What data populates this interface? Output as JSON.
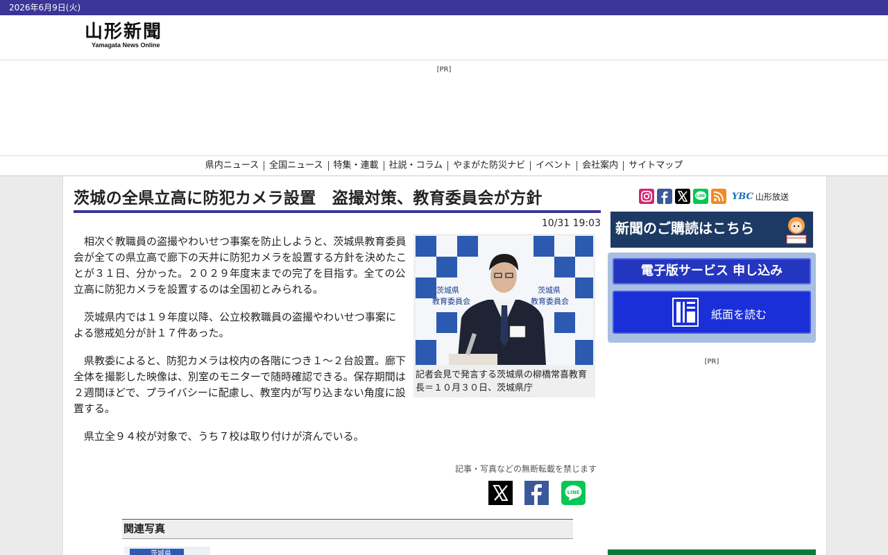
{
  "datebar": {
    "date": "2026年6月9日(火)"
  },
  "header": {
    "logo_kanji": "山形新聞",
    "logo_sub": "Yamagata News Online"
  },
  "ad": {
    "pr_label": "[PR]"
  },
  "nav": {
    "items": [
      "県内ニュース",
      "全国ニュース",
      "特集・連載",
      "社説・コラム",
      "やまがた防災ナビ",
      "イベント",
      "会社案内",
      "サイトマップ"
    ]
  },
  "article": {
    "headline": "茨城の全県立高に防犯カメラ設置　盗撮対策、教育委員会が方針",
    "timestamp": "10/31 19:03",
    "paragraphs": [
      "相次ぐ教職員の盗撮やわいせつ事案を防止しようと、茨城県教育委員会が全ての県立高で廊下の天井に防犯カメラを設置する方針を決めたことが３１日、分かった。２０２９年度末までの完了を目指す。全ての公立高に防犯カメラを設置するのは全国初とみられる。",
      "茨城県内では１９年度以降、公立校教職員の盗撮やわいせつ事案による懲戒処分が計１７件あった。",
      "県教委によると、防犯カメラは校内の各階につき１〜２台設置。廊下全体を撮影した映像は、別室のモニターで随時確認できる。保存期間は２週間ほどで、プライバシーに配慮し、教室内が写り込まない角度に設置する。",
      "県立全９４校が対象で、うち７校は取り付けが済んでいる。"
    ],
    "photo_caption": "記者会見で発言する茨城県の柳橋常喜教育長＝１０月３０日、茨城県庁",
    "photo_backdrop_text": [
      "茨城県",
      "教育委員会"
    ],
    "copyright": "記事・写真などの無断転載を禁じます",
    "related_heading": "関連写真",
    "related_thumb_text": "茨城県"
  },
  "sidebar": {
    "social_icons": [
      "instagram-icon",
      "facebook-icon",
      "x-icon",
      "line-icon",
      "rss-icon"
    ],
    "ybc_mark": "YBC",
    "ybc_label": "山形放送",
    "subscribe_label": "新聞のご購読はこちら",
    "eservice_label": "電子版サービス 申し込み",
    "read_label": "紙面を読む",
    "pr_label": "[PR]"
  },
  "colors": {
    "brand_purple": "#3b3597",
    "subscribe_navy": "#1c3a63",
    "eservice_blue": "#2436c0",
    "line_green": "#06c755",
    "facebook_blue": "#3b5998"
  }
}
